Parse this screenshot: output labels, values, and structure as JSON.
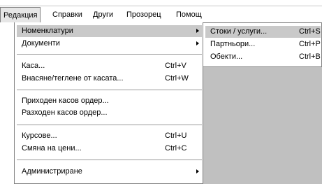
{
  "menubar": {
    "items": [
      "Редакция",
      "Справки",
      "Други",
      "Прозорец",
      "Помощ"
    ]
  },
  "menu": {
    "items": [
      {
        "label": "Номенклатури",
        "shortcut": "",
        "submenu": true
      },
      {
        "label": "Документи",
        "shortcut": "",
        "submenu": true
      },
      {
        "label": "Каса...",
        "shortcut": "Ctrl+V"
      },
      {
        "label": "Внасяне/теглене от касата...",
        "shortcut": "Ctrl+W"
      },
      {
        "label": "Приходен касов ордер..."
      },
      {
        "label": "Разходен касов ордер..."
      },
      {
        "label": "Курсове...",
        "shortcut": "Ctrl+U"
      },
      {
        "label": "Смяна на цени...",
        "shortcut": "Ctrl+C"
      },
      {
        "label": "Администриране",
        "submenu": true
      }
    ]
  },
  "submenu": {
    "items": [
      {
        "label": "Стоки / услуги...",
        "shortcut": "Ctrl+S"
      },
      {
        "label": "Партньори...",
        "shortcut": "Ctrl+P"
      },
      {
        "label": "Обекти...",
        "shortcut": "Ctrl+B"
      }
    ]
  },
  "colors": {
    "highlight": "#c9c9c9",
    "workspace": "#c0c0c0",
    "border": "#808080"
  }
}
